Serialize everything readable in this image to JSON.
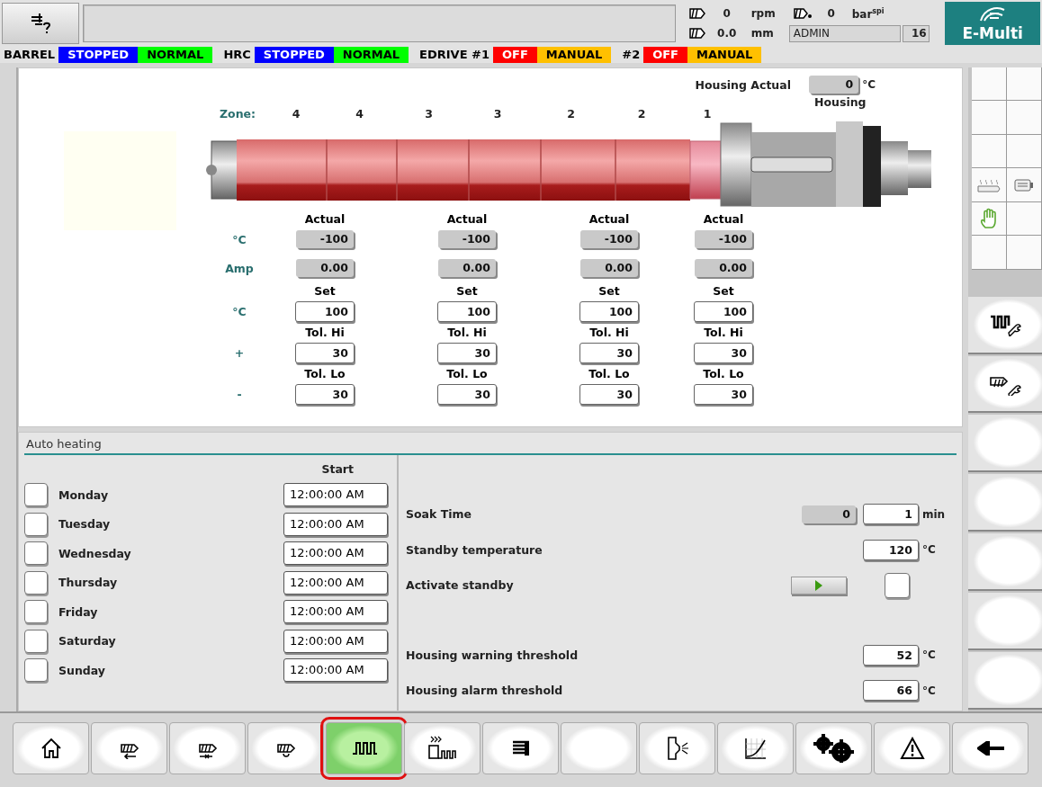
{
  "header": {
    "stats": {
      "speed_value": "0",
      "speed_unit": "rpm",
      "pressure_value": "0",
      "pressure_unit": "bar$^{spi}$",
      "stroke_value": "0.0",
      "stroke_unit": "mm",
      "user": "ADMIN",
      "user_level": "16"
    },
    "brand": "E-Multi"
  },
  "status_strip": [
    {
      "kind": "label",
      "text": "BARREL"
    },
    {
      "kind": "state",
      "text": "STOPPED",
      "color": "#0000ff"
    },
    {
      "kind": "state",
      "text": "NORMAL",
      "color": "#00ff00"
    },
    {
      "kind": "label",
      "text": "HRC"
    },
    {
      "kind": "state",
      "text": "STOPPED",
      "color": "#0000ff"
    },
    {
      "kind": "state",
      "text": "NORMAL",
      "color": "#00ff00"
    },
    {
      "kind": "label",
      "text": "EDRIVE #1"
    },
    {
      "kind": "state",
      "text": "OFF",
      "color": "#ff0000"
    },
    {
      "kind": "state",
      "text": "MANUAL",
      "color": "#ffc000"
    },
    {
      "kind": "label",
      "text": "#2"
    },
    {
      "kind": "state",
      "text": "OFF",
      "color": "#ff0000"
    },
    {
      "kind": "state",
      "text": "MANUAL",
      "color": "#ffc000"
    }
  ],
  "housing": {
    "label": "Housing Actual",
    "value": "0",
    "unit": "°C",
    "caption": "Housing"
  },
  "zones": {
    "label": "Zone:",
    "numbers": [
      "4",
      "4",
      "3",
      "3",
      "2",
      "2",
      "1"
    ]
  },
  "row_labels": [
    "°C",
    "Amp",
    "°C",
    "+",
    "-"
  ],
  "zone_columns": [
    {
      "actual_label": "Actual",
      "actual_temp": "-100",
      "current": "0.00",
      "set_label": "Set",
      "set": "100",
      "tol_hi_label": "Tol. Hi",
      "tol_hi": "30",
      "tol_lo_label": "Tol. Lo",
      "tol_lo": "30"
    },
    {
      "actual_label": "Actual",
      "actual_temp": "-100",
      "current": "0.00",
      "set_label": "Set",
      "set": "100",
      "tol_hi_label": "Tol. Hi",
      "tol_hi": "30",
      "tol_lo_label": "Tol. Lo",
      "tol_lo": "30"
    },
    {
      "actual_label": "Actual",
      "actual_temp": "-100",
      "current": "0.00",
      "set_label": "Set",
      "set": "100",
      "tol_hi_label": "Tol. Hi",
      "tol_hi": "30",
      "tol_lo_label": "Tol. Lo",
      "tol_lo": "30"
    },
    {
      "actual_label": "Actual",
      "actual_temp": "-100",
      "current": "0.00",
      "set_label": "Set",
      "set": "100",
      "tol_hi_label": "Tol. Hi",
      "tol_hi": "30",
      "tol_lo_label": "Tol. Lo",
      "tol_lo": "30"
    }
  ],
  "auto_heating": {
    "title": "Auto heating",
    "start_label": "Start",
    "days": [
      {
        "day": "Monday",
        "checked": false,
        "start": "12:00:00 AM"
      },
      {
        "day": "Tuesday",
        "checked": false,
        "start": "12:00:00 AM"
      },
      {
        "day": "Wednesday",
        "checked": false,
        "start": "12:00:00 AM"
      },
      {
        "day": "Thursday",
        "checked": false,
        "start": "12:00:00 AM"
      },
      {
        "day": "Friday",
        "checked": false,
        "start": "12:00:00 AM"
      },
      {
        "day": "Saturday",
        "checked": false,
        "start": "12:00:00 AM"
      },
      {
        "day": "Sunday",
        "checked": false,
        "start": "12:00:00 AM"
      }
    ],
    "settings": [
      {
        "kind": "soak",
        "label": "Soak Time",
        "reading": "0",
        "value": "1",
        "unit": "min"
      },
      {
        "kind": "input",
        "label": "Standby temperature",
        "value": "120",
        "unit": "°C"
      },
      {
        "kind": "toggle",
        "label": "Activate standby",
        "checked": false
      }
    ],
    "thresholds": [
      {
        "kind": "input",
        "label": "Housing warning threshold",
        "value": "52",
        "unit": "°C"
      },
      {
        "kind": "input",
        "label": "Housing alarm threshold",
        "value": "66",
        "unit": "°C"
      }
    ]
  },
  "side_buttons": [
    {
      "kind": "heater-tool"
    },
    {
      "kind": "screw-tool"
    },
    {
      "kind": "blank"
    },
    {
      "kind": "blank"
    },
    {
      "kind": "blank"
    },
    {
      "kind": "blank"
    },
    {
      "kind": "blank"
    }
  ],
  "nav": [
    {
      "kind": "home",
      "selected": false
    },
    {
      "kind": "screw-back",
      "selected": false
    },
    {
      "kind": "screw-jog",
      "selected": false
    },
    {
      "kind": "screw-rotate",
      "selected": false
    },
    {
      "kind": "heating",
      "selected": true
    },
    {
      "kind": "heat-wave",
      "selected": false
    },
    {
      "kind": "list",
      "selected": false
    },
    {
      "kind": "blank",
      "selected": false
    },
    {
      "kind": "nozzle",
      "selected": false
    },
    {
      "kind": "chart",
      "selected": false
    },
    {
      "kind": "gears",
      "selected": false
    },
    {
      "kind": "warning",
      "selected": false
    },
    {
      "kind": "back",
      "selected": false
    }
  ]
}
